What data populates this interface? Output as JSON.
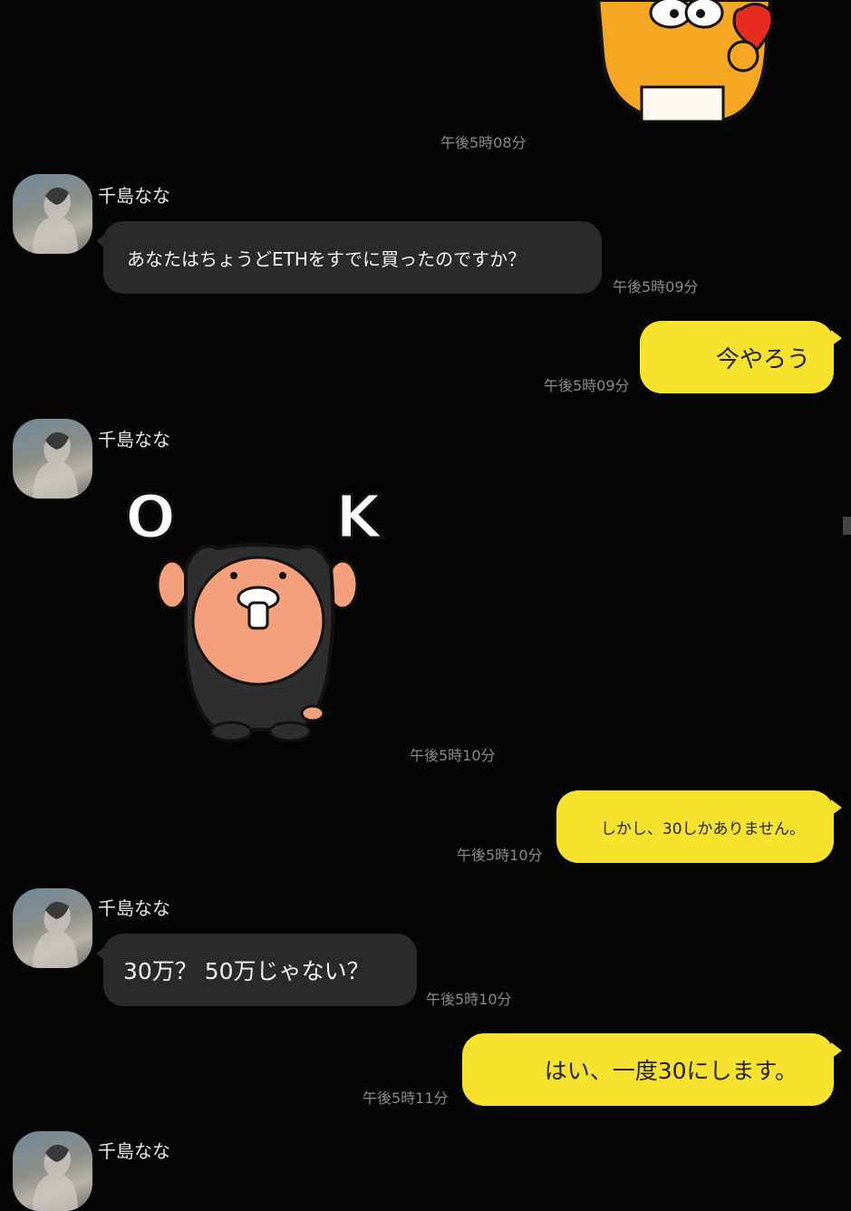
{
  "contact": {
    "name": "千島なな"
  },
  "colors": {
    "background": "#050505",
    "incoming_bubble": "#2a2a2a",
    "outgoing_bubble": "#f7e32d",
    "timestamp": "#8a8a8a"
  },
  "messages": [
    {
      "type": "sticker",
      "sender": "me",
      "sticker": "orange-bear-heart-sticker",
      "time": "午後5時08分"
    },
    {
      "type": "text",
      "sender": "contact",
      "text": "あなたはちょうどETHをすでに買ったのですか？",
      "time": "午後5時09分"
    },
    {
      "type": "text",
      "sender": "me",
      "text": "今やろう",
      "time": "午後5時09分"
    },
    {
      "type": "sticker",
      "sender": "contact",
      "sticker": "ok-otter-sticker",
      "sticker_text": "O K",
      "time": "午後5時10分"
    },
    {
      "type": "text",
      "sender": "me",
      "text": "しかし、30しかありません。",
      "time": "午後5時10分"
    },
    {
      "type": "text",
      "sender": "contact",
      "text": "30万？ 50万じゃない？",
      "time": "午後5時10分"
    },
    {
      "type": "text",
      "sender": "me",
      "text": "はい、一度30にします。",
      "time": "午後5時11分"
    }
  ]
}
